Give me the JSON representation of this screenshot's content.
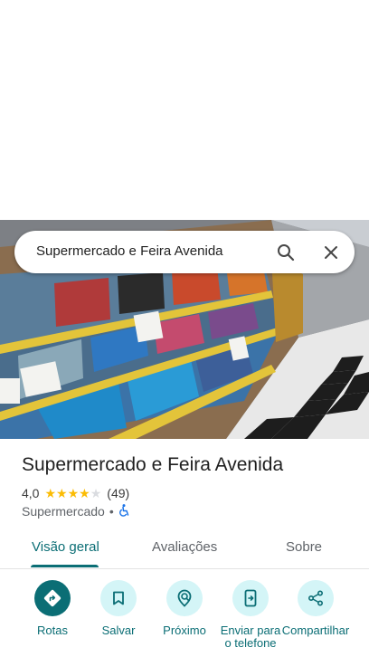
{
  "search": {
    "text": "Supermercado e Feira Avenida",
    "search_icon": "search-icon",
    "close_icon": "close-icon"
  },
  "place": {
    "name": "Supermercado e Feira Avenida",
    "rating": "4,0",
    "stars_filled": 4,
    "stars_total": 5,
    "review_count": "(49)",
    "category": "Supermercado",
    "separator": "•",
    "accessibility_icon": "wheelchair-icon"
  },
  "tabs": [
    {
      "label": "Visão geral",
      "active": true
    },
    {
      "label": "Avaliações",
      "active": false
    },
    {
      "label": "Sobre",
      "active": false
    }
  ],
  "actions": [
    {
      "label": "Rotas",
      "icon": "directions-icon"
    },
    {
      "label": "Salvar",
      "icon": "bookmark-icon"
    },
    {
      "label": "Próximo",
      "icon": "nearby-icon"
    },
    {
      "label": "Enviar para o telefone",
      "icon": "send-to-phone-icon"
    },
    {
      "label": "Compartilhar",
      "icon": "share-icon"
    }
  ],
  "colors": {
    "accent": "#0b6e75",
    "accent_light": "#d4f5f7",
    "star": "#fbbc04"
  }
}
